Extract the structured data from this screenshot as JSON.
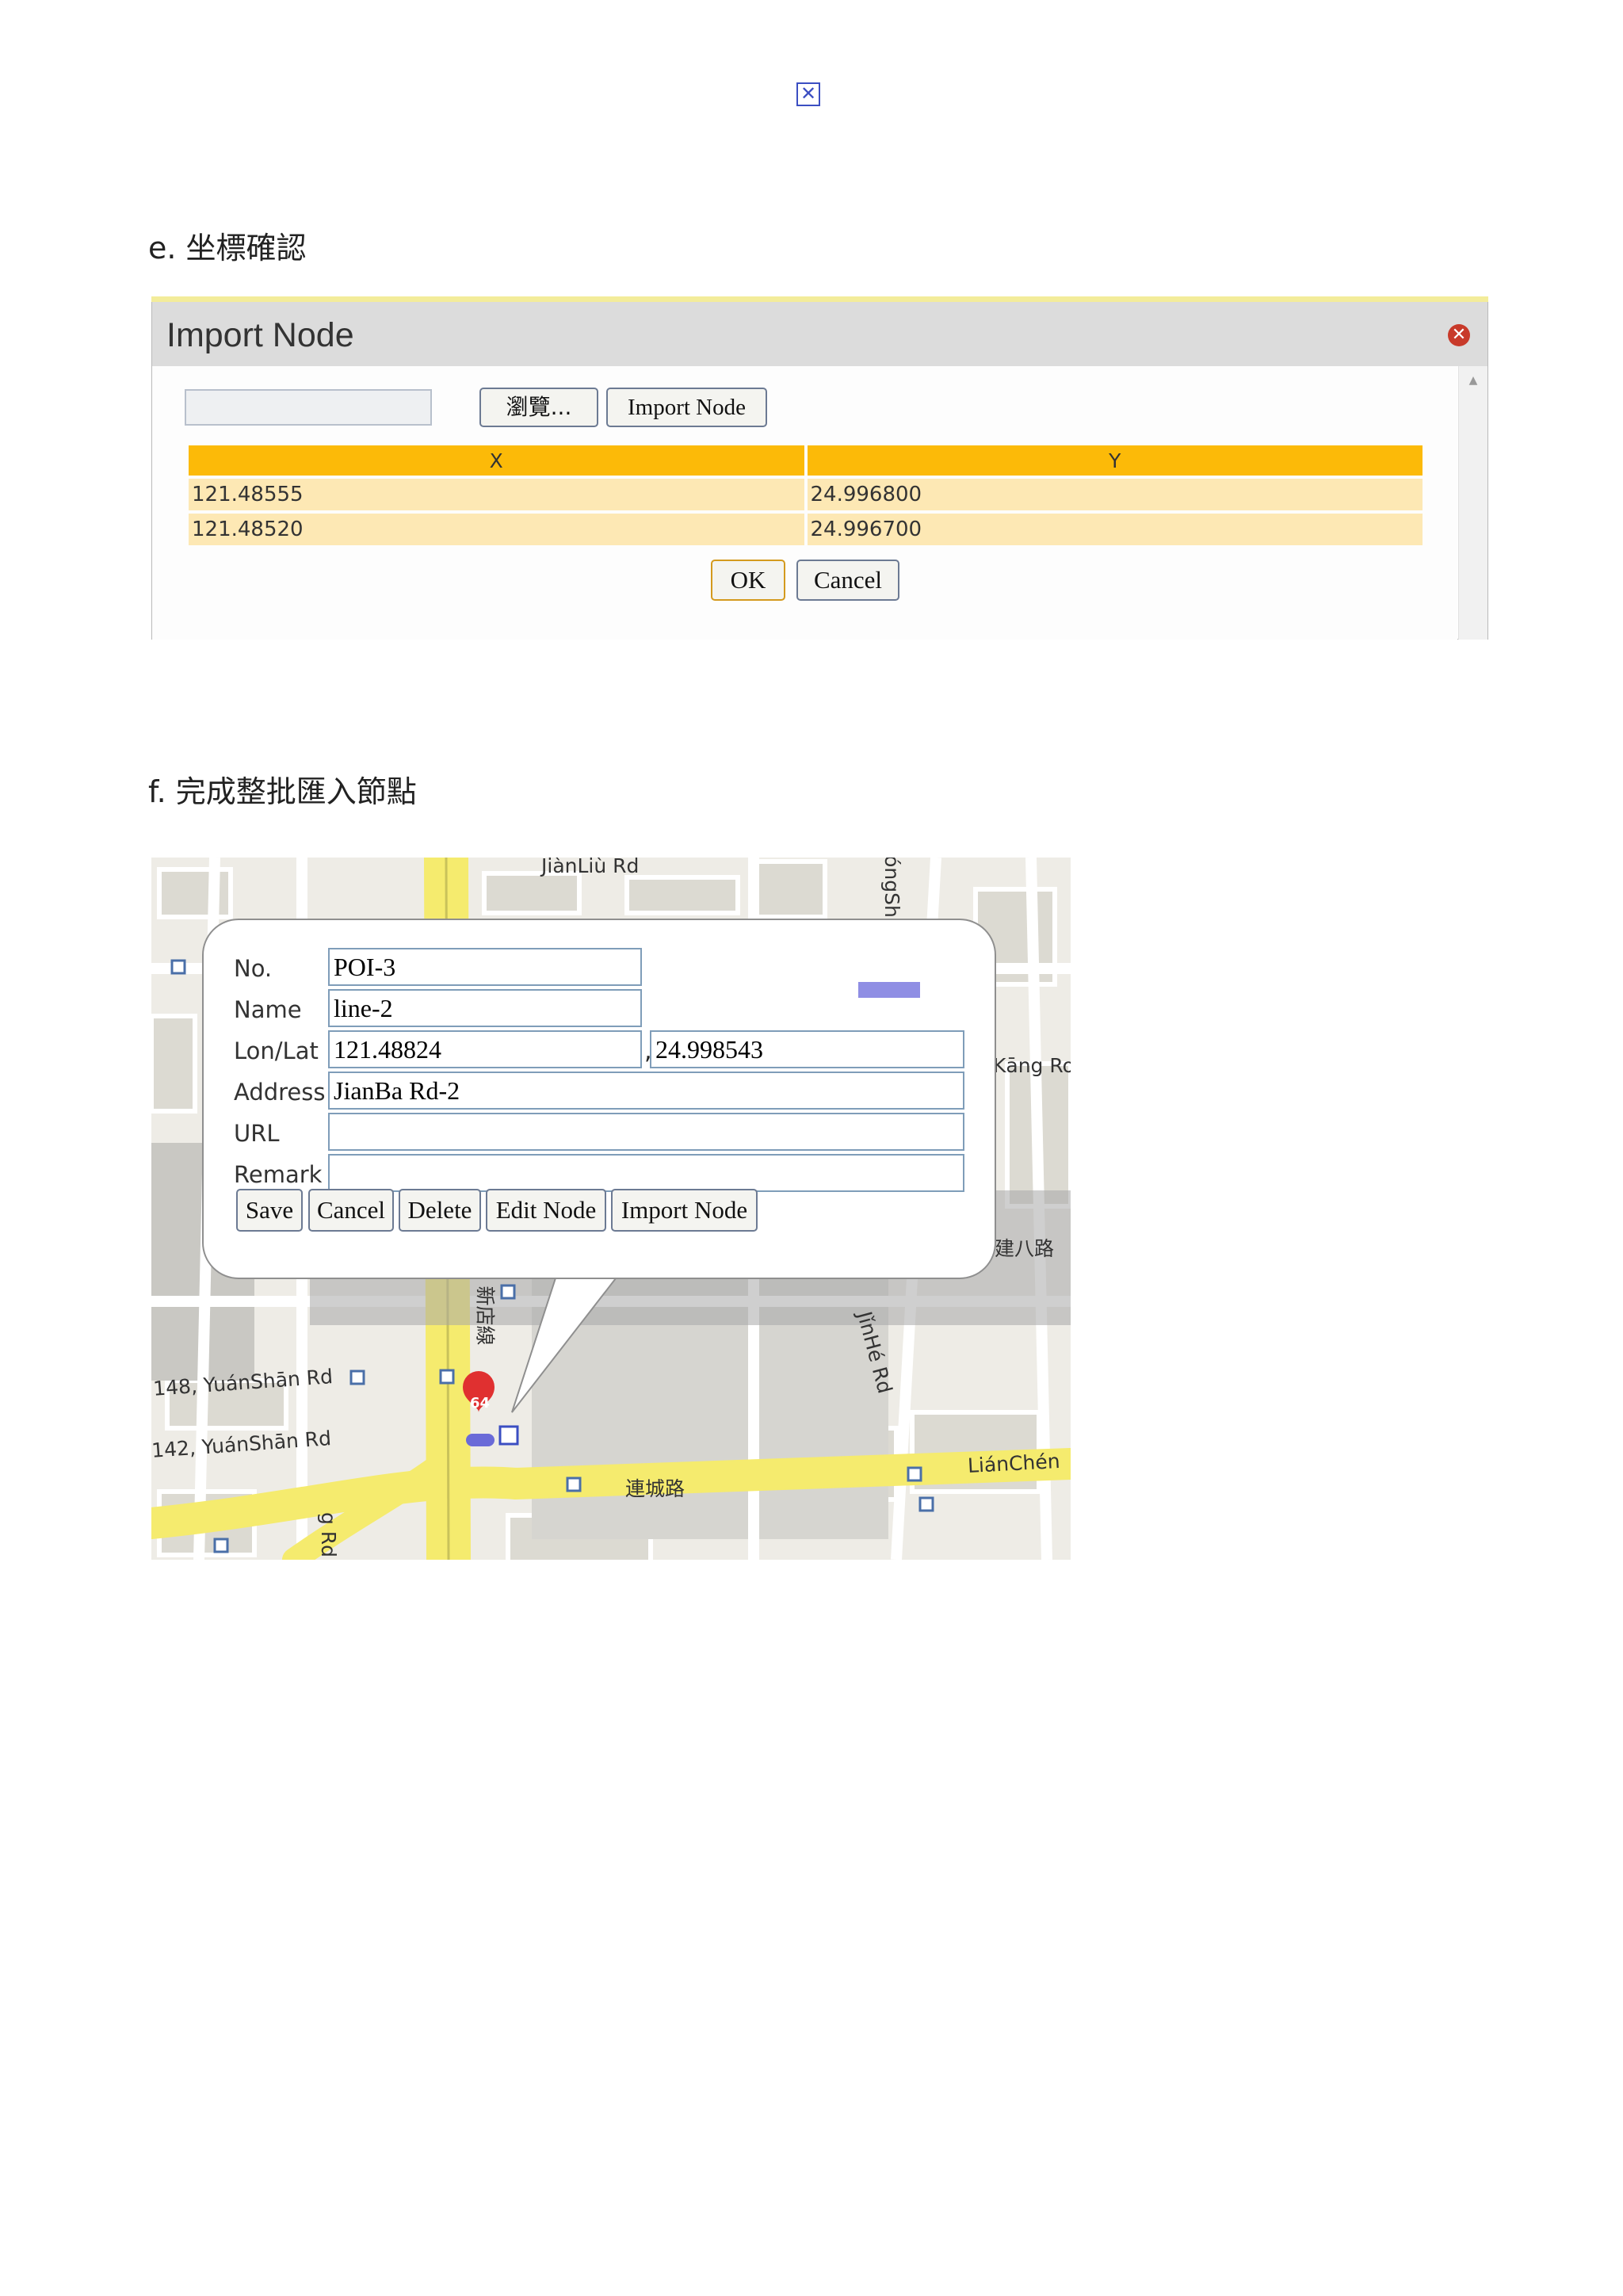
{
  "headings": {
    "e": "e.  坐標確認",
    "f": "f.  完成整批匯入節點"
  },
  "import_dialog": {
    "title": "Import Node",
    "browse_label": "瀏覽...",
    "import_label": "Import Node",
    "table": {
      "columns": [
        "X",
        "Y"
      ],
      "rows": [
        [
          "121.48555",
          "24.996800"
        ],
        [
          "121.48520",
          "24.996700"
        ]
      ]
    },
    "ok_label": "OK",
    "cancel_label": "Cancel"
  },
  "map": {
    "road_labels": {
      "jianliu": "JiànLiù Rd",
      "yongshi": "óngSh",
      "kang": "Kāng Ro",
      "jianba": "建八路",
      "xindian": "新店線",
      "jinhe": "JǐnHé Rd",
      "yuanshan148": "148, YuánShān Rd",
      "yuanshan142": "142, YuánShān Rd",
      "liancheng_cn": "連城路",
      "liancheng": "LiánChén",
      "route": "64",
      "bottom_left": "g Rd"
    },
    "popup": {
      "labels": {
        "no": "No.",
        "name": "Name",
        "lonlat": "Lon/Lat",
        "address": "Address",
        "url": "URL",
        "remark": "Remark"
      },
      "values": {
        "no": "POI-3",
        "name": "line-2",
        "lon": "121.48824",
        "lat": "24.998543",
        "address": "JianBa Rd-2",
        "url": "",
        "remark": ""
      },
      "separator": ",",
      "buttons": {
        "save": "Save",
        "cancel": "Cancel",
        "delete": "Delete",
        "edit_node": "Edit Node",
        "import_node": "Import Node"
      }
    }
  }
}
